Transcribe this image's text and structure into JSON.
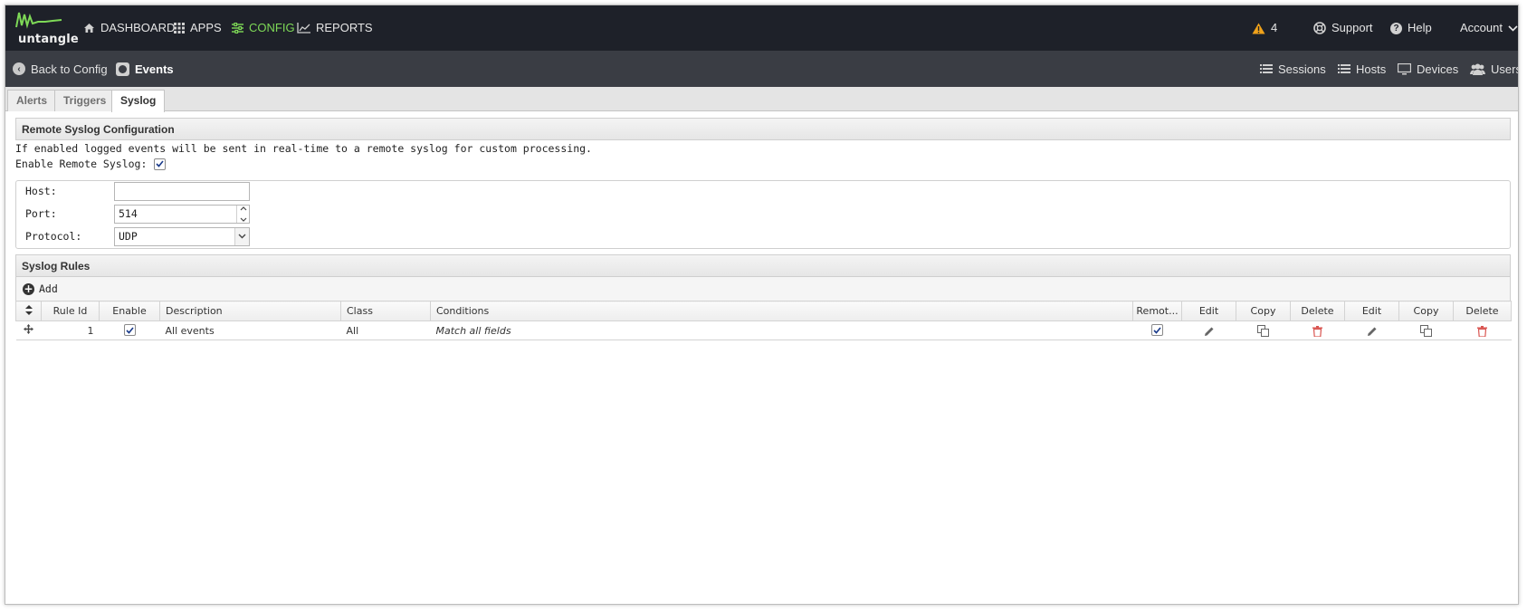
{
  "brand": {
    "name": "untangle"
  },
  "nav": {
    "items": [
      {
        "label": "DASHBOARD",
        "icon": "home-icon"
      },
      {
        "label": "APPS",
        "icon": "grid-icon"
      },
      {
        "label": "CONFIG",
        "icon": "sliders-icon",
        "active": true
      },
      {
        "label": "REPORTS",
        "icon": "line-chart-icon"
      }
    ],
    "alerts_count": "4",
    "support_label": "Support",
    "help_label": "Help",
    "account_label": "Account"
  },
  "subnav": {
    "back_label": "Back to Config",
    "current_label": "Events",
    "right_items": [
      "Sessions",
      "Hosts",
      "Devices",
      "Users"
    ]
  },
  "tabs": [
    "Alerts",
    "Triggers",
    "Syslog"
  ],
  "active_tab": "Syslog",
  "remote_syslog": {
    "title": "Remote Syslog Configuration",
    "description": "If enabled logged events will be sent in real-time to a remote syslog for custom processing.",
    "enable_label": "Enable Remote Syslog:",
    "enable_checked": true,
    "host_label": "Host:",
    "host_value": "",
    "port_label": "Port:",
    "port_value": "514",
    "protocol_label": "Protocol:",
    "protocol_value": "UDP"
  },
  "syslog_rules": {
    "title": "Syslog Rules",
    "add_label": "Add",
    "columns": [
      "Rule Id",
      "Enable",
      "Description",
      "Class",
      "Conditions",
      "Remot...",
      "Edit",
      "Copy",
      "Delete",
      "Edit",
      "Copy",
      "Delete"
    ],
    "rows": [
      {
        "rule_id": "1",
        "enable": true,
        "description": "All events",
        "class": "All",
        "conditions": "Match all fields",
        "remote": true
      }
    ]
  },
  "colors": {
    "nav_bg": "#1e2129",
    "subnav_bg": "#3a3d44",
    "accent_green": "#7ed957",
    "alert_orange": "#f0a21a",
    "delete_red": "#d9534f"
  }
}
